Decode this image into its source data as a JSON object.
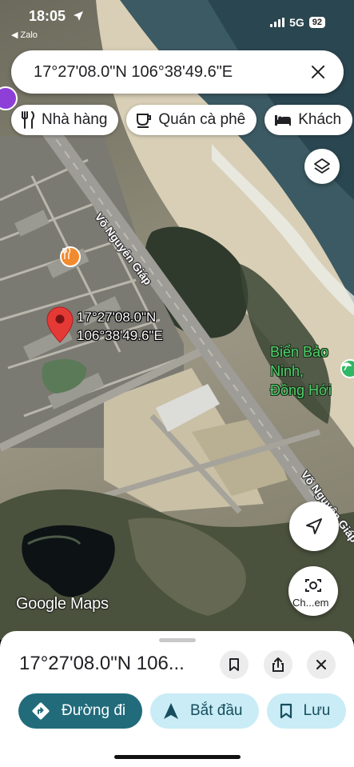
{
  "status_bar": {
    "time": "18:05",
    "back_app": "◀ Zalo",
    "network": "5G",
    "battery": "92"
  },
  "search": {
    "query": "17°27'08.0\"N 106°38'49.6\"E"
  },
  "chips": [
    {
      "label": "Nhà hàng",
      "icon": "fork-knife-icon"
    },
    {
      "label": "Quán cà phê",
      "icon": "coffee-cup-icon"
    },
    {
      "label": "Khách",
      "icon": "bed-icon"
    }
  ],
  "map": {
    "pin_label_line1": "17°27'08.0\"N",
    "pin_label_line2": "106°38'49.6\"E",
    "road_label_1": "Võ Nguyên Giáp",
    "road_label_2": "Võ Nguyên Giáp",
    "poi_line1": "Biển Bảo",
    "poi_line2": "Ninh,",
    "poi_line3": "Đồng Hới",
    "attribution": "Google Maps",
    "camera_caption": "Ch...em"
  },
  "place": {
    "title": "17°27'08.0\"N 106..."
  },
  "actions": {
    "directions": "Đường đi",
    "start": "Bắt đầu",
    "save": "Lưu"
  },
  "colors": {
    "primary_button": "#216b7b",
    "secondary_button": "#c9ecf6",
    "pin": "#e53935"
  }
}
